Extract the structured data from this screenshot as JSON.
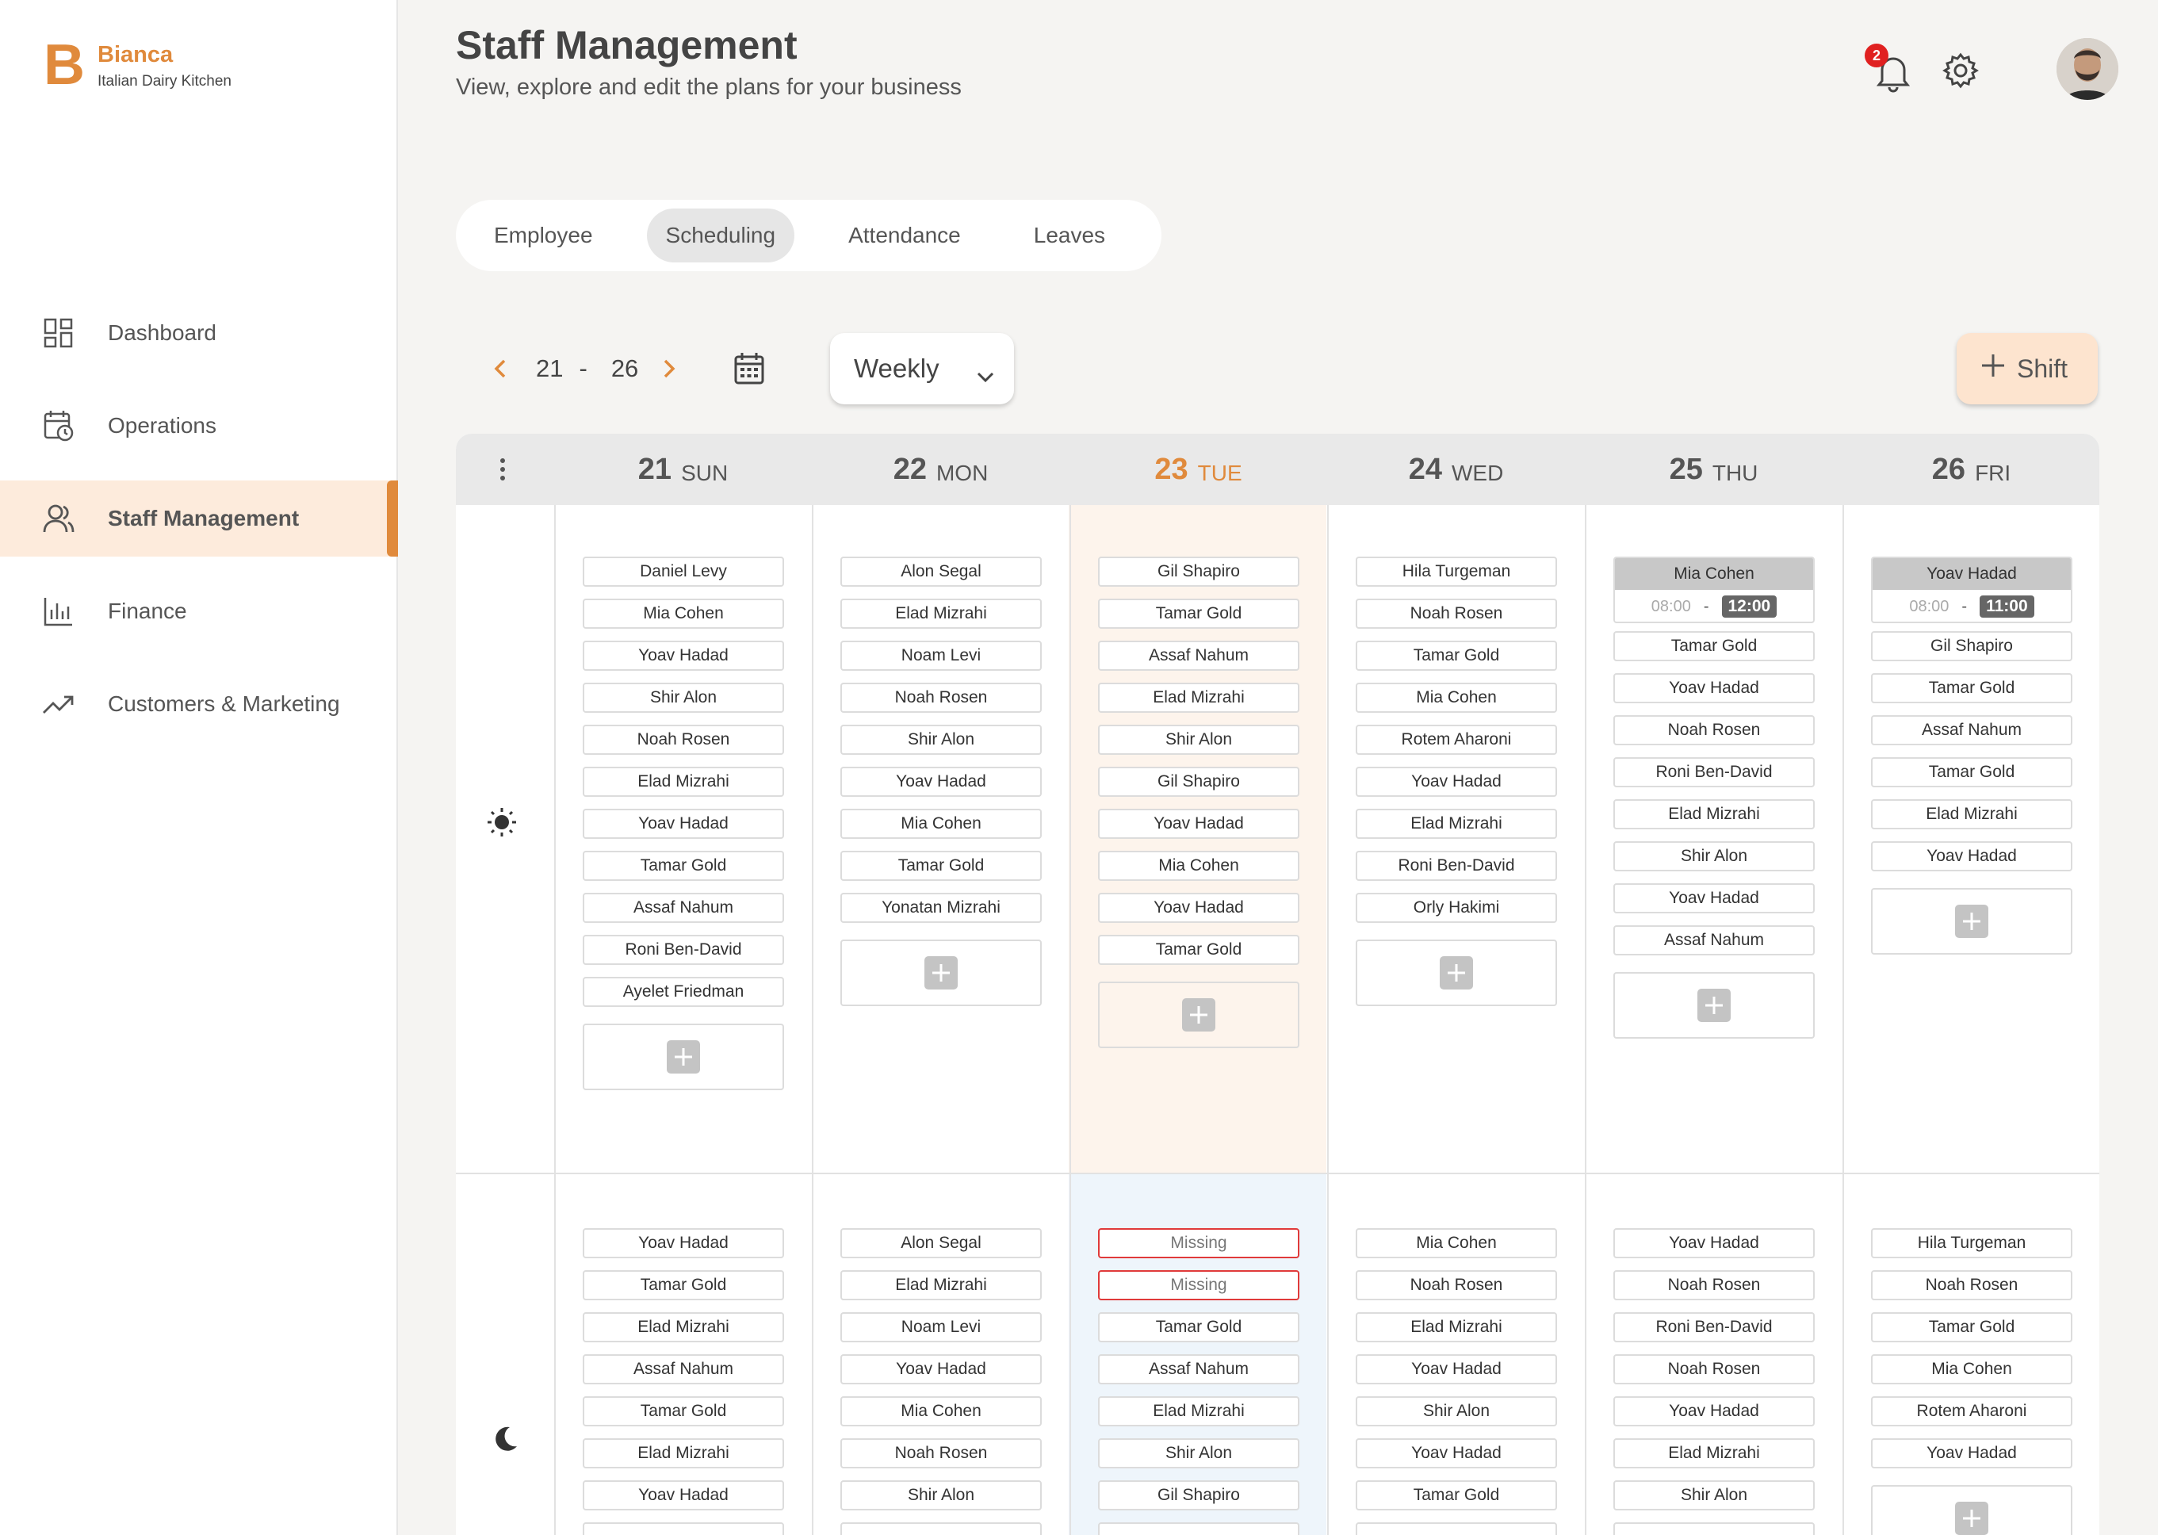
{
  "brand": {
    "letter": "B",
    "name": "Bianca",
    "subtitle": "Italian Dairy Kitchen"
  },
  "nav": {
    "items": [
      {
        "label": "Dashboard",
        "icon": "dashboard-icon"
      },
      {
        "label": "Operations",
        "icon": "calendar-clock-icon"
      },
      {
        "label": "Staff Management",
        "icon": "staff-icon",
        "active": true
      },
      {
        "label": "Finance",
        "icon": "bar-chart-icon"
      },
      {
        "label": "Customers & Marketing",
        "icon": "trending-up-icon"
      }
    ]
  },
  "header": {
    "title": "Staff Management",
    "subtitle": "View, explore and edit the plans for your business",
    "notifications": "2"
  },
  "tabs": [
    {
      "label": "Employee"
    },
    {
      "label": "Scheduling",
      "active": true
    },
    {
      "label": "Attendance"
    },
    {
      "label": "Leaves"
    }
  ],
  "range": {
    "start": "21",
    "sep": "-",
    "end": "26"
  },
  "view": {
    "selected": "Weekly"
  },
  "shift_button": {
    "label": "Shift"
  },
  "colors": {
    "accent": "#e08a3c",
    "today_morning": "#fdf4ec",
    "today_evening": "#eef5fb",
    "missing": "#e03a3a"
  },
  "days": [
    {
      "num": "21",
      "dow": "SUN"
    },
    {
      "num": "22",
      "dow": "MON"
    },
    {
      "num": "23",
      "dow": "TUE",
      "today": true
    },
    {
      "num": "24",
      "dow": "WED"
    },
    {
      "num": "25",
      "dow": "THU"
    },
    {
      "num": "26",
      "dow": "FRI"
    }
  ],
  "morning": [
    {
      "names": [
        "Daniel Levy",
        "Mia Cohen",
        "Yoav Hadad",
        "Shir Alon",
        "Noah Rosen",
        "Elad Mizrahi",
        "Yoav Hadad",
        "Tamar Gold",
        "Assaf Nahum",
        "Roni Ben-David",
        "Ayelet Friedman"
      ]
    },
    {
      "names": [
        "Alon Segal",
        "Elad Mizrahi",
        "Noam Levi",
        "Noah Rosen",
        "Shir Alon",
        "Yoav Hadad",
        "Mia Cohen",
        "Tamar Gold",
        "Yonatan Mizrahi"
      ]
    },
    {
      "names": [
        "Gil Shapiro",
        "Tamar Gold",
        "Assaf Nahum",
        "Elad Mizrahi",
        "Shir Alon",
        "Gil Shapiro",
        "Yoav Hadad",
        "Mia Cohen",
        "Yoav Hadad",
        "Tamar Gold"
      ]
    },
    {
      "names": [
        "Hila Turgeman",
        "Noah Rosen",
        "Tamar Gold",
        "Mia Cohen",
        "Rotem Aharoni",
        "Yoav Hadad",
        "Elad Mizrahi",
        "Roni Ben-David",
        "Orly Hakimi"
      ]
    },
    {
      "timed": {
        "name": "Mia Cohen",
        "start": "08:00",
        "end": "12:00"
      },
      "names": [
        "Tamar Gold",
        "Yoav Hadad",
        "Noah Rosen",
        "Roni Ben-David",
        "Elad Mizrahi",
        "Shir Alon",
        "Yoav Hadad",
        "Assaf Nahum"
      ]
    },
    {
      "timed": {
        "name": "Yoav Hadad",
        "start": "08:00",
        "end": "11:00"
      },
      "names": [
        "Gil Shapiro",
        "Tamar Gold",
        "Assaf Nahum",
        "Tamar Gold",
        "Elad Mizrahi",
        "Yoav Hadad"
      ]
    }
  ],
  "evening": [
    {
      "names": [
        "Yoav Hadad",
        "Tamar Gold",
        "Elad Mizrahi",
        "Assaf Nahum",
        "Tamar Gold",
        "Elad Mizrahi",
        "Yoav Hadad"
      ]
    },
    {
      "names": [
        "Alon Segal",
        "Elad Mizrahi",
        "Noam Levi",
        "Yoav Hadad",
        "Mia Cohen",
        "Noah Rosen",
        "Shir Alon"
      ]
    },
    {
      "names": [
        "Missing",
        "Missing",
        "Tamar Gold",
        "Assaf Nahum",
        "Elad Mizrahi",
        "Shir Alon",
        "Gil Shapiro"
      ],
      "missing": [
        0,
        1
      ]
    },
    {
      "names": [
        "Mia Cohen",
        "Noah Rosen",
        "Elad Mizrahi",
        "Yoav Hadad",
        "Shir Alon",
        "Yoav Hadad",
        "Tamar Gold"
      ]
    },
    {
      "names": [
        "Yoav Hadad",
        "Noah Rosen",
        "Roni Ben-David",
        "Noah Rosen",
        "Yoav Hadad",
        "Elad Mizrahi",
        "Shir Alon"
      ]
    },
    {
      "names": [
        "Hila Turgeman",
        "Noah Rosen",
        "Tamar Gold",
        "Mia Cohen",
        "Rotem Aharoni",
        "Yoav Hadad"
      ]
    }
  ]
}
